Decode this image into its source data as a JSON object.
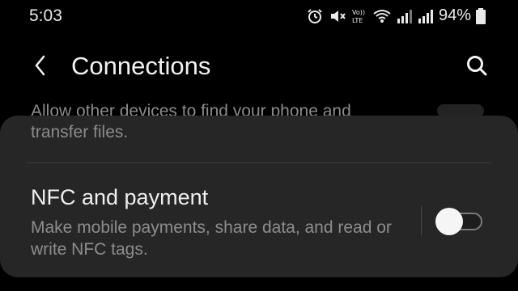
{
  "status_bar": {
    "time": "5:03",
    "battery": "94%",
    "icons": [
      "alarm-icon",
      "mute-icon",
      "volte-icon",
      "wifi-icon",
      "signal-icon",
      "signal-icon",
      "battery-icon"
    ]
  },
  "header": {
    "title": "Connections",
    "back_icon": "back-arrow-icon",
    "search_icon": "search-icon"
  },
  "previous_item": {
    "description_clipped": "Allow other devices to find your phone and",
    "description_continued": "transfer files."
  },
  "nfc": {
    "title": "NFC and payment",
    "description": "Make mobile payments, share data, and read or write NFC tags.",
    "toggle_state": "off"
  },
  "colors": {
    "background": "#000000",
    "card": "#262626",
    "secondary_text": "#8d8d8d"
  }
}
